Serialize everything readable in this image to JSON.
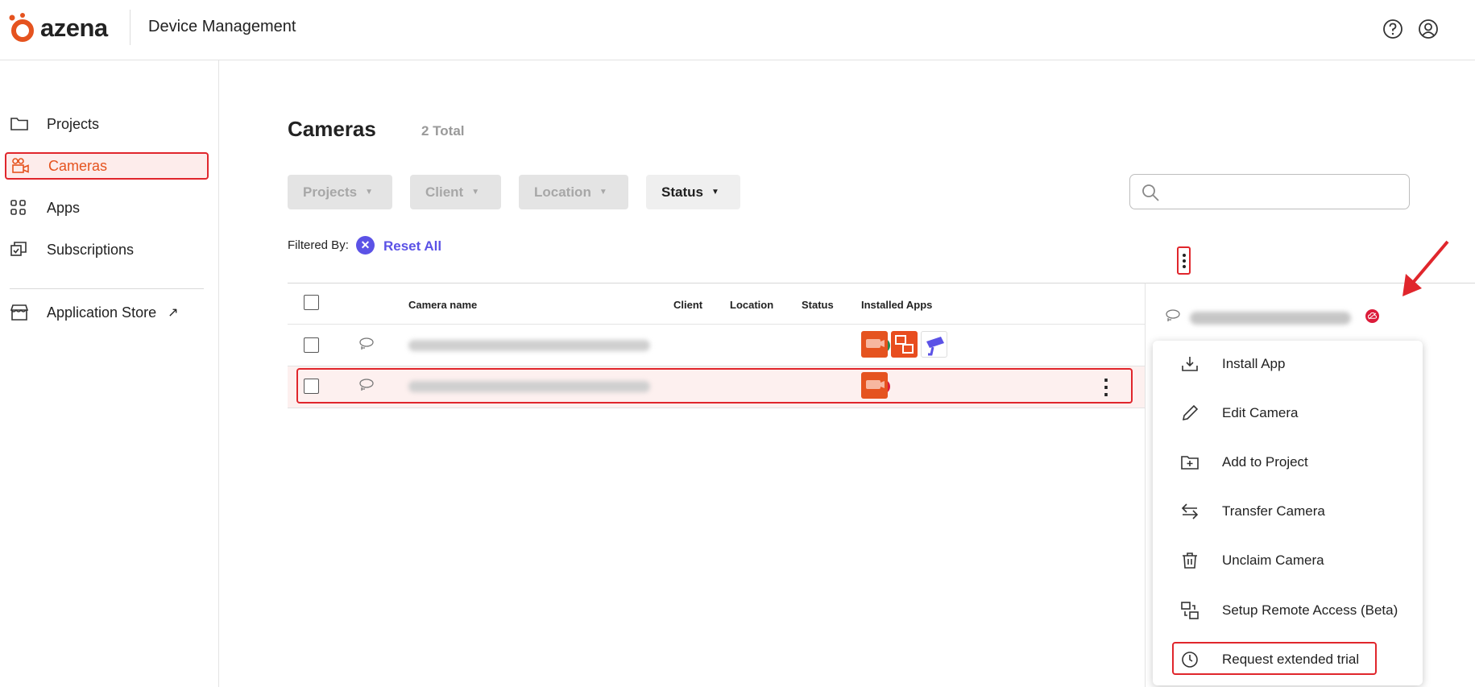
{
  "header": {
    "logo_text": "azena",
    "app_title": "Device Management",
    "icons": [
      "help-icon",
      "user-icon"
    ]
  },
  "sidebar": {
    "items": [
      {
        "label": "Projects",
        "icon": "folder-icon"
      },
      {
        "label": "Cameras",
        "icon": "camera-icon",
        "active": true
      },
      {
        "label": "Apps",
        "icon": "apps-grid-icon"
      },
      {
        "label": "Subscriptions",
        "icon": "subscriptions-icon"
      },
      {
        "label": "Application Store",
        "icon": "store-icon",
        "external": true
      }
    ]
  },
  "main": {
    "title": "Cameras",
    "total": "2 Total",
    "filters": [
      {
        "label": "Projects",
        "enabled": false
      },
      {
        "label": "Client",
        "enabled": false
      },
      {
        "label": "Location",
        "enabled": false
      },
      {
        "label": "Status",
        "enabled": true
      }
    ],
    "search": {
      "placeholder": ""
    },
    "filtered_by_label": "Filtered By:",
    "reset_all_label": "Reset All"
  },
  "table": {
    "columns": [
      "Camera name",
      "Client",
      "Location",
      "Status",
      "Installed Apps"
    ],
    "rows": [
      {
        "status": "online",
        "apps": [
          "orange-camera-app",
          "orange-remote-app",
          "purple-camera-app"
        ],
        "selected": false
      },
      {
        "status": "offline",
        "apps": [
          "orange-camera-app"
        ],
        "selected": true
      }
    ]
  },
  "context_menu": {
    "items": [
      {
        "label": "Install App",
        "icon": "install-icon"
      },
      {
        "label": "Edit Camera",
        "icon": "pencil-icon"
      },
      {
        "label": "Add to Project",
        "icon": "folder-plus-icon"
      },
      {
        "label": "Transfer Camera",
        "icon": "transfer-icon"
      },
      {
        "label": "Unclaim Camera",
        "icon": "trash-icon"
      },
      {
        "label": "Setup Remote Access (Beta)",
        "icon": "remote-access-icon"
      },
      {
        "label": "Request extended trial",
        "icon": "clock-icon",
        "highlighted": true
      }
    ]
  },
  "colors": {
    "brand_orange": "#e5531f",
    "accent_purple": "#5b52e6",
    "highlight_red": "#e0262c",
    "status_online": "#1f8a52",
    "status_offline": "#dc1b3a"
  }
}
